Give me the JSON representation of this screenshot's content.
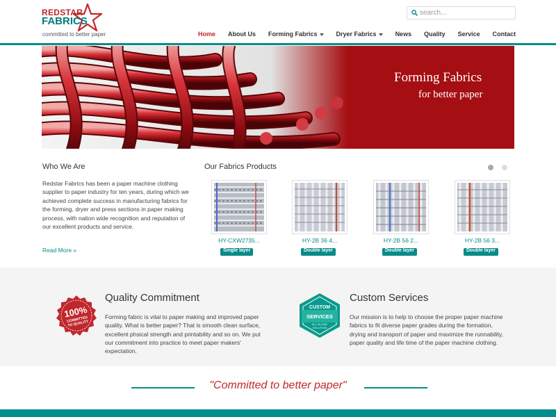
{
  "brand": {
    "name_top": "REDSTAR",
    "name_bottom": "FABRICS",
    "tagline": "committed to better paper",
    "colors": {
      "red": "#c0272d",
      "teal": "#008d8d"
    }
  },
  "search": {
    "placeholder": "search...",
    "value": ""
  },
  "nav": {
    "items": [
      {
        "label": "Home",
        "active": true
      },
      {
        "label": "About Us"
      },
      {
        "label": "Forming Fabrics",
        "dropdown": true
      },
      {
        "label": "Dryer Fabrics",
        "dropdown": true
      },
      {
        "label": "News"
      },
      {
        "label": "Quality"
      },
      {
        "label": "Service"
      },
      {
        "label": "Contact"
      }
    ]
  },
  "hero": {
    "title": "Forming Fabrics",
    "subtitle": "for better paper"
  },
  "who": {
    "title": "Who We Are",
    "text": "Redstar Fabrics has been a paper machine clothing supplier to paper industry for ten years, during which we achieved complete success in manufacturing fabrics for the forming, dryer and press sections in paper making process, with nation wide recognition and reputation of our excellent products and service.",
    "read_more": "Read More »"
  },
  "products": {
    "title": "Our Fabrics Products",
    "carousel_page": 1,
    "carousel_pages": 2,
    "items": [
      {
        "name": "HY-CXW2735...",
        "badge": "Single layer"
      },
      {
        "name": "HY-2B 36 4...",
        "badge": "Double layer"
      },
      {
        "name": "HY-2B 56 2...",
        "badge": "Double layer"
      },
      {
        "name": "HY-2B 56 3...",
        "badge": "Double layer"
      }
    ]
  },
  "quality": {
    "title": "Quality Commitment",
    "text": "Forming fabric is vital to paper making and improved paper quality. What is better paper? That is smooth clean surface, excellent phsical strength and printability and so on. We put our commitment into practice to meet paper makers' expectation.",
    "badge_big": "100%",
    "badge_small_1": "COMMITTED",
    "badge_small_2": "TO QUALITY"
  },
  "custom": {
    "title": "Custom Services",
    "text": "Our mission is to help to choose the proper paper machine fabrics to fit diverse paper grades during the formation, drying and transport of paper and maximize the runnability, paper quality and life time of the paper machine clothing.",
    "badge_line1": "CUSTOM",
    "badge_line2": "SERVICES",
    "badge_line3": "ALL-IN-ONE",
    "badge_line4": "SOLUTION"
  },
  "motto": "\"Committed to better paper\""
}
